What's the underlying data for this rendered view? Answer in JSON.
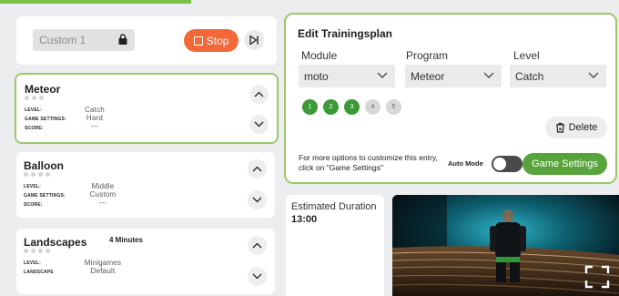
{
  "session": {
    "plan_name": "Custom 1",
    "stop_label": "Stop"
  },
  "entries": [
    {
      "title": "Meteor",
      "duration": "",
      "labels": [
        "LEVEL:",
        "GAME SETTINGS:",
        "SCORE:"
      ],
      "values": [
        "Catch",
        "Hard",
        "---"
      ]
    },
    {
      "title": "Balloon",
      "duration": "",
      "labels": [
        "LEVEL:",
        "GAME SETTINGS:",
        "SCORE:"
      ],
      "values": [
        "Middle",
        "Custom",
        "---"
      ]
    },
    {
      "title": "Landscapes",
      "duration": "4 Minutes",
      "labels": [
        "LEVEL:",
        "LANDSCAPE"
      ],
      "values": [
        "Minigames",
        "Default"
      ]
    }
  ],
  "edit": {
    "title": "Edit Trainingsplan",
    "module_label": "Module",
    "module_value": "moto",
    "program_label": "Program",
    "program_value": "Meteor",
    "level_label": "Level",
    "level_value": "Catch",
    "levels": [
      "1",
      "2",
      "3",
      "4",
      "5"
    ],
    "active_levels": 3,
    "delete_label": "Delete",
    "hint": "For more options to customize this entry, click on \"Game Settings\"",
    "auto_mode_label": "Auto Mode",
    "auto_mode_on": false,
    "game_settings_label": "Game Settings"
  },
  "duration": {
    "label": "Estimated Duration",
    "value": "13:00"
  },
  "colors": {
    "accent_green": "#58a43c",
    "level_green": "#3b9a35",
    "stop_orange": "#f36838",
    "frame_green": "#9ac86b"
  }
}
